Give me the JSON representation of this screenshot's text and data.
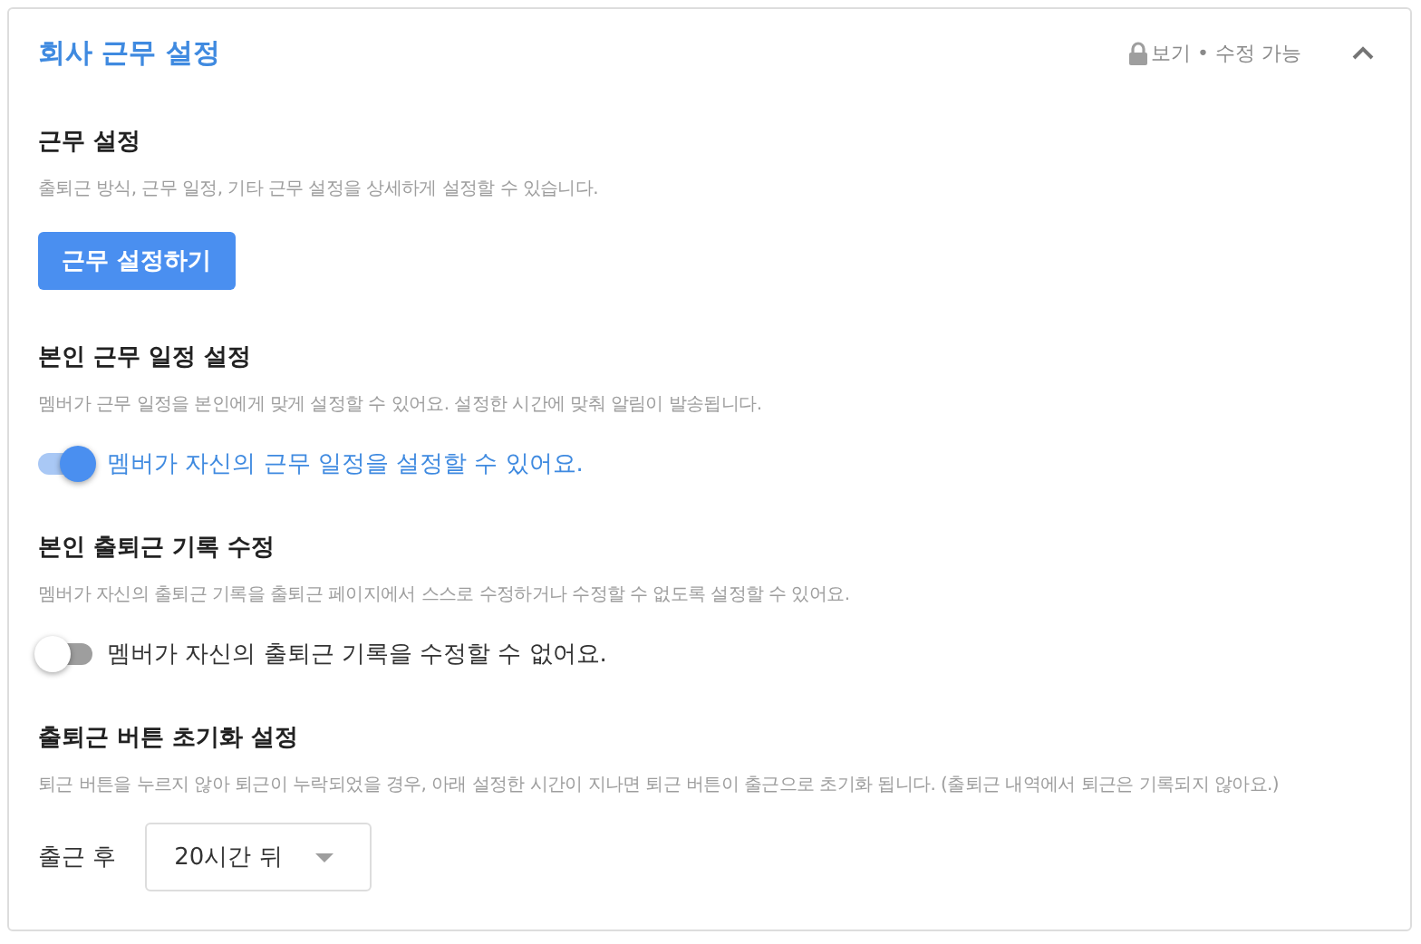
{
  "panel": {
    "title": "회사 근무 설정",
    "permission": "보기 • 수정 가능",
    "expanded": true
  },
  "sections": [
    {
      "kind": "button",
      "title": "근무 설정",
      "description": "출퇴근 방식, 근무 일정, 기타 근무 설정을 상세하게 설정할 수 있습니다.",
      "button": "근무 설정하기"
    },
    {
      "kind": "toggle",
      "title": "본인 근무 일정 설정",
      "description": "멤버가 근무 일정을 본인에게 맞게 설정할 수 있어요. 설정한 시간에 맞춰 알림이 발송됩니다.",
      "on": true,
      "label": "멤버가 자신의 근무 일정을 설정할 수 있어요."
    },
    {
      "kind": "toggle",
      "title": "본인 출퇴근 기록 수정",
      "description": "멤버가 자신의 출퇴근 기록을 출퇴근 페이지에서 스스로 수정하거나 수정할 수 없도록 설정할 수 있어요.",
      "on": false,
      "label": "멤버가 자신의 출퇴근 기록을 수정할 수 없어요."
    },
    {
      "kind": "select",
      "title": "출퇴근 버튼 초기화 설정",
      "description": "퇴근 버튼을 누르지 않아 퇴근이 누락되었을 경우, 아래 설정한 시간이 지나면 퇴근 버튼이 출근으로 초기화 됩니다. (출퇴근 내역에서 퇴근은 기록되지 않아요.)",
      "label": "출근 후",
      "value": "20시간 뒤"
    }
  ]
}
